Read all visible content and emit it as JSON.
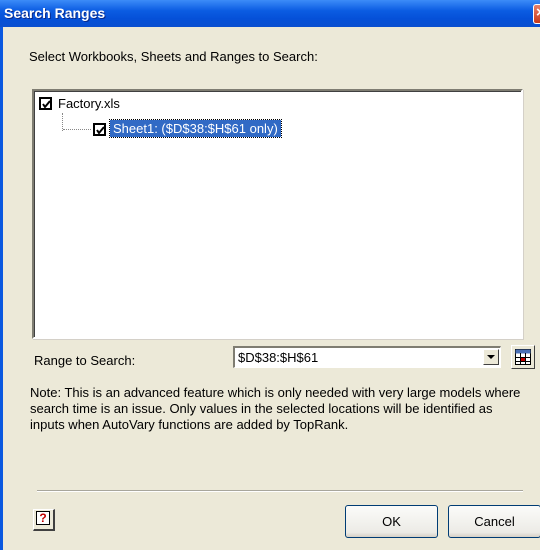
{
  "window": {
    "title": "Search Ranges"
  },
  "instruction": "Select Workbooks, Sheets and Ranges to Search:",
  "tree": {
    "nodes": [
      {
        "label": "Factory.xls",
        "checked": true
      },
      {
        "label": "Sheet1:  ($D$38:$H$61 only)",
        "checked": true,
        "selected": true
      }
    ]
  },
  "range": {
    "label": "Range to Search:",
    "value": "$D$38:$H$61"
  },
  "note": "Note: This is an advanced feature which is only needed with very large models where search time is an issue.  Only values in the selected locations will be identified as inputs when AutoVary functions are added by TopRank.",
  "buttons": {
    "help": "?",
    "ok": "OK",
    "cancel": "Cancel"
  },
  "icons": {
    "close": "close-icon",
    "checkbox": "checkmark-icon",
    "dropdown": "chevron-down-icon",
    "picker": "range-selector-icon",
    "help": "help-icon"
  },
  "colors": {
    "titlebar": "#0550d8",
    "selection": "#316ac5",
    "dialog": "#ece9d8"
  }
}
